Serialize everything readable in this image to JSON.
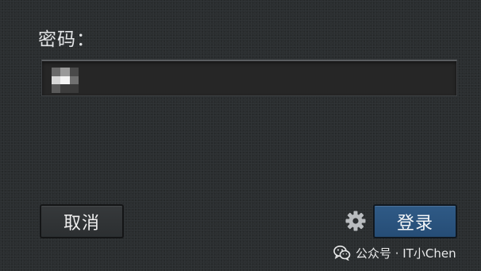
{
  "dialog": {
    "password_label": "密码：",
    "password_value": "••",
    "cancel_label": "取消",
    "login_label": "登录",
    "settings_icon": "gear-icon"
  },
  "watermark": {
    "icon": "wechat-icon",
    "text": "公众号 · IT小Chen"
  },
  "colors": {
    "background": "#2b2e30",
    "field_background": "#262626",
    "login_button": "#2a5580",
    "text": "#e4e6e8"
  }
}
